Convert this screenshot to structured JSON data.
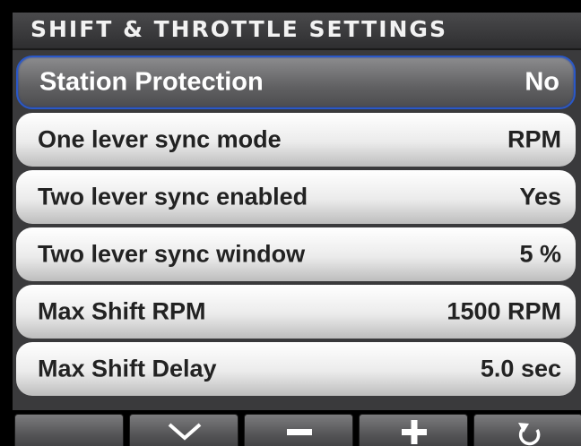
{
  "header": {
    "title": "SHIFT & THROTTLE SETTINGS"
  },
  "settings": [
    {
      "label": "Station Protection",
      "value": "No",
      "selected": true
    },
    {
      "label": "One lever sync mode",
      "value": "RPM",
      "selected": false
    },
    {
      "label": "Two lever sync enabled",
      "value": "Yes",
      "selected": false
    },
    {
      "label": "Two lever sync window",
      "value": "5 %",
      "selected": false
    },
    {
      "label": "Max Shift RPM",
      "value": "1500 RPM",
      "selected": false
    },
    {
      "label": "Max Shift Delay",
      "value": "5.0 sec",
      "selected": false
    }
  ],
  "softkeys": [
    {
      "icon": "blank"
    },
    {
      "icon": "chevron-down-icon"
    },
    {
      "icon": "minus-icon"
    },
    {
      "icon": "plus-icon"
    },
    {
      "icon": "back-rotate-icon"
    }
  ],
  "colors": {
    "selection_border": "#2a58c8",
    "title_bg": "#3a3a3c"
  }
}
